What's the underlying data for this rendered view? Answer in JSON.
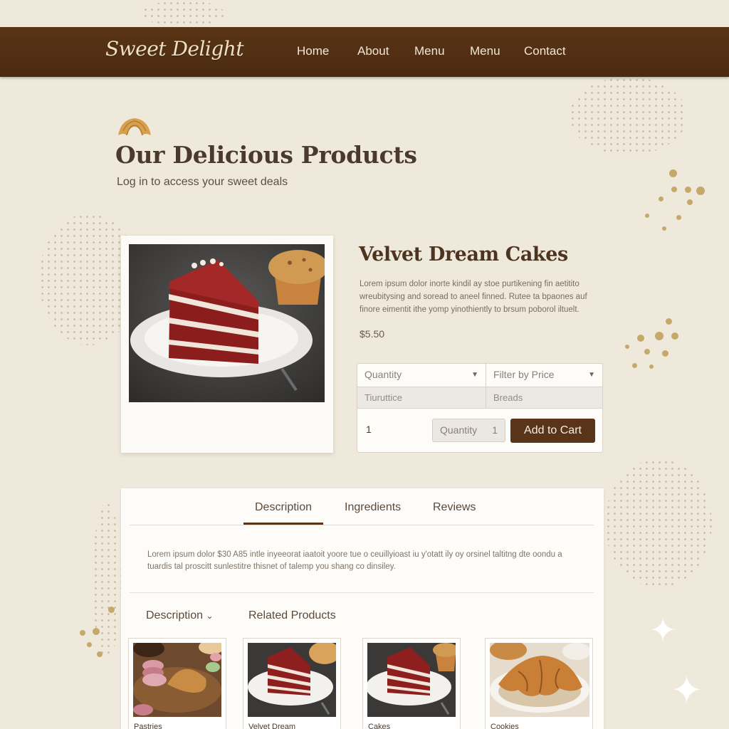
{
  "header": {
    "logo": "Sweet Delight",
    "nav": [
      "Home",
      "About",
      "Menu",
      "Menu",
      "Contact"
    ]
  },
  "page": {
    "title": "Our Delicious Products",
    "subtitle": "Log in to access your sweet deals"
  },
  "product": {
    "name": "Velvet Dream Cakes",
    "description": "Lorem ipsum dolor inorte kindil ay stoe purtikening fin aetitito wreubitysing and soread to aneel finned. Rutee ta bpaones auf finore eimentit ithe yomp yinothiently to brsum poborol iltuelt.",
    "price": "$5.50"
  },
  "filters": {
    "quantity_select": "Quantity",
    "price_select": "Filter by Price",
    "option_left": "Tiuruttice",
    "option_right": "Breads",
    "quantity_value": "1",
    "stepper_label": "Quantity",
    "stepper_value": "1",
    "add_to_cart": "Add to Cart"
  },
  "tabs": {
    "items": [
      "Description",
      "Ingredients",
      "Reviews"
    ],
    "active": "Description",
    "content": "Lorem ipsum dolor $30 A85 intle inyeeorat iaatoit yoore tue o ceuillyioast iu y'otatt ily oy orsinel taltitng dte oondu a tuardis tal proscitt sunlestitre thisnet of talemp you shang co dinsiley."
  },
  "related": {
    "dropdown_label": "Description",
    "heading": "Related Products",
    "items": [
      "Pastries",
      "Velvet Dream",
      "Cakes",
      "Cookies"
    ]
  },
  "colors": {
    "header_bg": "#4b2a10",
    "accent": "#5a3418",
    "page_bg": "#efe9dc"
  }
}
